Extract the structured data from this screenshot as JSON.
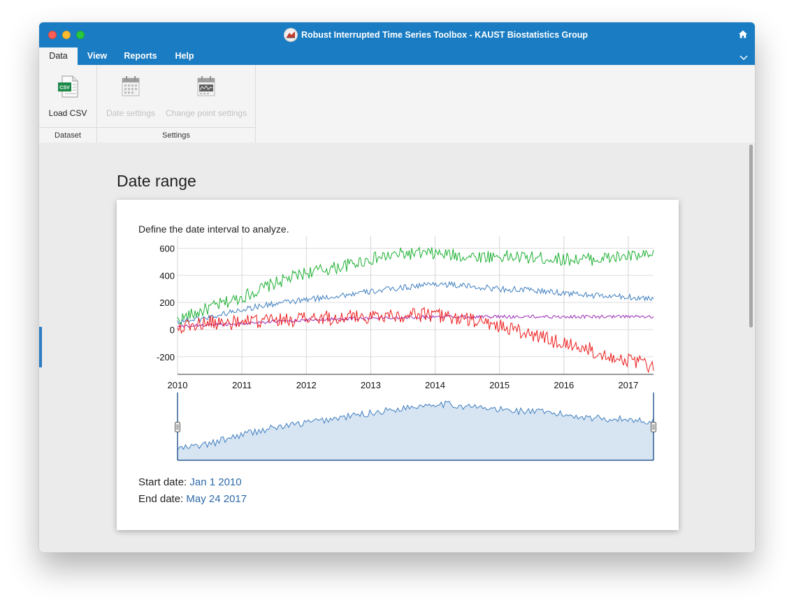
{
  "window": {
    "title": "Robust Interrupted Time Series Toolbox - KAUST Biostatistics Group"
  },
  "menu": {
    "tabs": [
      "Data",
      "View",
      "Reports",
      "Help"
    ],
    "active": "Data"
  },
  "ribbon": {
    "groups": [
      {
        "label": "Dataset",
        "buttons": [
          {
            "label": "Load CSV",
            "icon": "csv-file-icon",
            "enabled": true
          }
        ]
      },
      {
        "label": "Settings",
        "buttons": [
          {
            "label": "Date settings",
            "icon": "calendar-icon",
            "enabled": false
          },
          {
            "label": "Change point settings",
            "icon": "calendar-changepoint-icon",
            "enabled": false
          }
        ]
      }
    ]
  },
  "content": {
    "section_title": "Date range",
    "description": "Define the date interval to analyze.",
    "start_label": "Start date:",
    "start_value": "Jan 1 2010",
    "end_label": "End date:",
    "end_value": "May 24 2017"
  },
  "chart_data": {
    "type": "line",
    "x_ticks": [
      "2010",
      "2011",
      "2012",
      "2013",
      "2014",
      "2015",
      "2016",
      "2017"
    ],
    "y_ticks": [
      600,
      400,
      200,
      0,
      -200
    ],
    "xlim": [
      "2010-01-01",
      "2017-05-24"
    ],
    "ylim": [
      -330,
      690
    ],
    "grid": true,
    "series": [
      {
        "color": "#1db033",
        "x": [
          2010.0,
          2010.5,
          2011.0,
          2011.5,
          2012.0,
          2012.5,
          2013.0,
          2013.5,
          2014.0,
          2014.5,
          2015.0,
          2015.5,
          2016.0,
          2016.5,
          2017.0,
          2017.38
        ],
        "values": [
          70,
          160,
          240,
          340,
          420,
          460,
          520,
          560,
          560,
          540,
          540,
          530,
          520,
          520,
          540,
          540
        ]
      },
      {
        "color": "#3f7fbf",
        "x": [
          2010.0,
          2010.5,
          2011.0,
          2011.5,
          2012.0,
          2012.5,
          2013.0,
          2013.5,
          2014.0,
          2014.5,
          2015.0,
          2015.5,
          2016.0,
          2016.5,
          2017.0,
          2017.38
        ],
        "values": [
          60,
          90,
          150,
          190,
          220,
          250,
          280,
          310,
          340,
          320,
          300,
          290,
          270,
          250,
          240,
          230
        ]
      },
      {
        "color": "#9a2bb5",
        "x": [
          2010.0,
          2010.5,
          2011.0,
          2011.5,
          2012.0,
          2012.5,
          2013.0,
          2013.5,
          2014.0,
          2014.5,
          2015.0,
          2015.5,
          2016.0,
          2016.5,
          2017.0,
          2017.38
        ],
        "values": [
          20,
          35,
          45,
          60,
          70,
          80,
          85,
          90,
          95,
          95,
          95,
          95,
          95,
          95,
          95,
          95
        ]
      },
      {
        "color": "#ee1c1c",
        "x": [
          2010.0,
          2010.5,
          2011.0,
          2011.5,
          2012.0,
          2012.5,
          2013.0,
          2013.5,
          2014.0,
          2014.5,
          2015.0,
          2015.5,
          2016.0,
          2016.5,
          2017.0,
          2017.38
        ],
        "values": [
          20,
          50,
          50,
          70,
          80,
          90,
          100,
          110,
          110,
          70,
          30,
          -40,
          -100,
          -160,
          -230,
          -270
        ]
      }
    ],
    "navigator": {
      "color": "#3f7fbf",
      "x": [
        2010.0,
        2010.5,
        2011.0,
        2011.5,
        2012.0,
        2012.5,
        2013.0,
        2013.5,
        2014.0,
        2014.5,
        2015.0,
        2015.5,
        2016.0,
        2016.5,
        2017.0,
        2017.38
      ],
      "values": [
        60,
        90,
        150,
        190,
        220,
        250,
        280,
        310,
        340,
        320,
        300,
        290,
        270,
        250,
        240,
        230
      ],
      "selection": [
        "2010-01-01",
        "2017-05-24"
      ]
    }
  },
  "colors": {
    "accent": "#1a7cc2",
    "link": "#2d6aa8"
  }
}
